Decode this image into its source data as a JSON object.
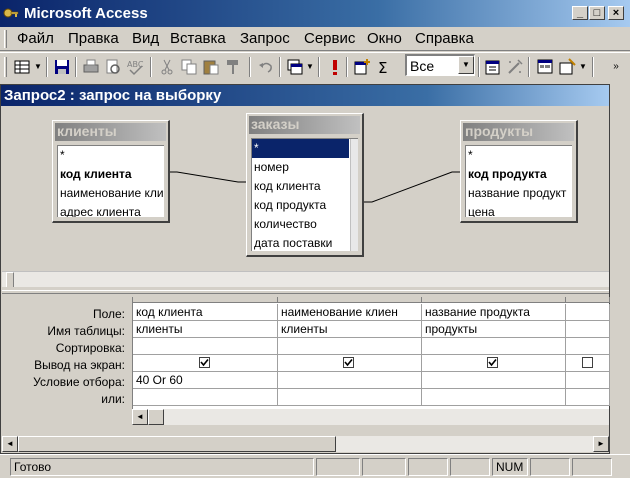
{
  "app": {
    "title": "Microsoft Access",
    "controls": {
      "minimize": "_",
      "maximize": "□",
      "close": "×"
    }
  },
  "menu": {
    "items": [
      "Файл",
      "Правка",
      "Вид",
      "Вставка",
      "Запрос",
      "Сервис",
      "Окно",
      "Справка"
    ]
  },
  "toolbar": {
    "combo_value": "Все",
    "buttons": [
      "view-icon",
      "save-icon",
      "print-icon",
      "print-preview-icon",
      "spelling-icon",
      "cut-icon",
      "copy-icon",
      "paste-icon",
      "format-painter-icon",
      "undo-icon",
      "query-type-icon",
      "run-icon",
      "show-table-icon",
      "totals-icon",
      "properties-icon",
      "build-icon",
      "database-window-icon",
      "new-object-icon"
    ]
  },
  "query_window": {
    "title": "Запрос2 : запрос на выборку",
    "tables": [
      {
        "name": "клиенты",
        "fields": [
          "*",
          "код клиента",
          "наименование кли",
          "адрес клиента"
        ]
      },
      {
        "name": "заказы",
        "fields": [
          "*",
          "номер",
          "код клиента",
          "код продукта",
          "количество",
          "дата поставки"
        ]
      },
      {
        "name": "продукты",
        "fields": [
          "*",
          "код продукта",
          "название продукт",
          "цена"
        ]
      }
    ],
    "grid": {
      "row_labels": [
        "Поле:",
        "Имя таблицы:",
        "Сортировка:",
        "Вывод на экран:",
        "Условие отбора:",
        "или:"
      ],
      "columns": [
        {
          "field": "код клиента",
          "table": "клиенты",
          "sort": "",
          "show": true,
          "criteria": "40 Or 60",
          "or": ""
        },
        {
          "field": "наименование клиен",
          "table": "клиенты",
          "sort": "",
          "show": true,
          "criteria": "",
          "or": ""
        },
        {
          "field": "название продукта",
          "table": "продукты",
          "sort": "",
          "show": true,
          "criteria": "",
          "or": ""
        },
        {
          "field": "",
          "table": "",
          "sort": "",
          "show": false,
          "criteria": "",
          "or": ""
        }
      ]
    }
  },
  "status": {
    "text": "Готово",
    "num": "NUM"
  }
}
